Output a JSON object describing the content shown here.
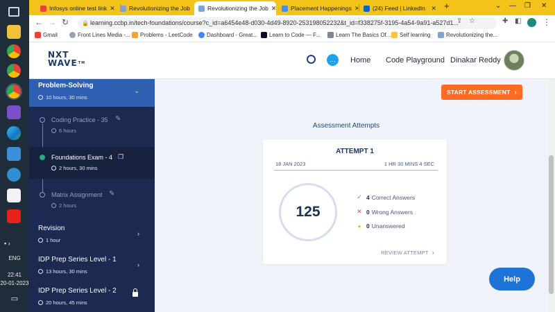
{
  "taskbar": {
    "language": "ENG",
    "time": "22:41",
    "date": "20-01-2023"
  },
  "browser": {
    "tabs": [
      {
        "label": "Infosys online test link",
        "icon": "gmail-icon",
        "active": false
      },
      {
        "label": "Revolutionizing the Job",
        "icon": "ccbp-icon",
        "active": false
      },
      {
        "label": "Revolutionizing the Job",
        "icon": "ccbp-icon",
        "active": true
      },
      {
        "label": "Placement Happenings",
        "icon": "drive-icon",
        "active": false
      },
      {
        "label": "(24) Feed | LinkedIn",
        "icon": "linkedin-icon",
        "active": false
      }
    ],
    "url": "learning.ccbp.in/tech-foundations/course?c_id=a6454e48-d030-4d49-8920-253198052232&t_id=f338275f-3195-4a54-9a91-a527d1...",
    "bookmarks": [
      "Gmail",
      "Front Lines Media -...",
      "Problems - LeetCode",
      "Dashboard - Great...",
      "Learn to Code — F...",
      "Learn The Basics Of...",
      "Self learning",
      "Revolutionizing the..."
    ]
  },
  "header": {
    "logo_line1": "NXT",
    "logo_line2": "WAVE",
    "logo_tm": "TM",
    "nav": [
      "Home",
      "Code Playground"
    ],
    "user_name": "Dinakar Reddy"
  },
  "sidebar": {
    "active_section": {
      "title": "Problem-Solving",
      "duration": "10 hours, 30 mins"
    },
    "items": [
      {
        "title": "Coding Practice - 35",
        "duration": "6 hours",
        "status": "pending"
      },
      {
        "title": "Foundations Exam - 4",
        "duration": "2 hours, 30 mins",
        "status": "completed"
      },
      {
        "title": "Matrix Assignment",
        "duration": "2 hours",
        "status": "pending"
      }
    ],
    "sections": [
      {
        "title": "Revision",
        "duration": "1 hour",
        "locked": false
      },
      {
        "title": "IDP Prep Series Level - 1",
        "duration": "13 hours, 30 mins",
        "locked": false
      },
      {
        "title": "IDP Prep Series Level - 2",
        "duration": "20 hours, 45 mins",
        "locked": true
      }
    ]
  },
  "main": {
    "start_button": "START ASSESSMENT",
    "attempts_title": "Assessment Attempts",
    "attempt": {
      "title": "ATTEMPT 1",
      "date": "18 JAN 2023",
      "duration": "1 HR 30 MINS 4 SEC",
      "score": "125",
      "correct": {
        "count": "4",
        "label": "Correct Answers"
      },
      "wrong": {
        "count": "0",
        "label": "Wrong Answers"
      },
      "unanswered": {
        "count": "0",
        "label": "Unanswered"
      },
      "review_label": "REVIEW ATTEMPT"
    },
    "help_label": "Help"
  },
  "colors": {
    "sidebar_bg": "#1c2a52",
    "sidebar_active": "#2f5fb0",
    "accent_orange": "#ff6b22",
    "help_blue": "#1d73d6",
    "correct_green": "#22b07a",
    "wrong_red": "#e0483c",
    "unanswered_yellow": "#f5b800"
  }
}
